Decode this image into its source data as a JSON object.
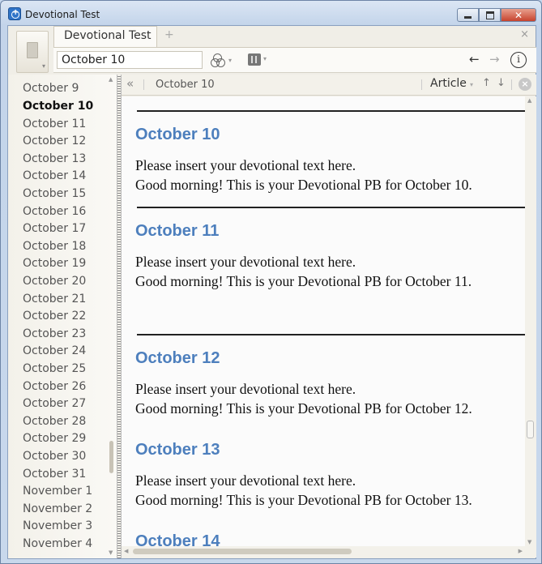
{
  "window": {
    "title": "Devotional Test"
  },
  "tab": {
    "label": "Devotional Test",
    "add_glyph": "+",
    "close_glyph": "×"
  },
  "toolbar": {
    "reference_value": "October 10",
    "back_glyph": "←",
    "forward_glyph": "→",
    "info_glyph": "i",
    "icons": [
      "library-book-icon",
      "resource-links-icon",
      "panels-icon",
      "back-arrow-icon",
      "forward-arrow-icon",
      "info-icon"
    ]
  },
  "sidebar": {
    "items": [
      {
        "label": "October 9",
        "active": false
      },
      {
        "label": "October 10",
        "active": true
      },
      {
        "label": "October 11",
        "active": false
      },
      {
        "label": "October 12",
        "active": false
      },
      {
        "label": "October 13",
        "active": false
      },
      {
        "label": "October 14",
        "active": false
      },
      {
        "label": "October 15",
        "active": false
      },
      {
        "label": "October 16",
        "active": false
      },
      {
        "label": "October 17",
        "active": false
      },
      {
        "label": "October 18",
        "active": false
      },
      {
        "label": "October 19",
        "active": false
      },
      {
        "label": "October 20",
        "active": false
      },
      {
        "label": "October 21",
        "active": false
      },
      {
        "label": "October 22",
        "active": false
      },
      {
        "label": "October 23",
        "active": false
      },
      {
        "label": "October 24",
        "active": false
      },
      {
        "label": "October 25",
        "active": false
      },
      {
        "label": "October 26",
        "active": false
      },
      {
        "label": "October 27",
        "active": false
      },
      {
        "label": "October 28",
        "active": false
      },
      {
        "label": "October 29",
        "active": false
      },
      {
        "label": "October 30",
        "active": false
      },
      {
        "label": "October 31",
        "active": false
      },
      {
        "label": "November 1",
        "active": false
      },
      {
        "label": "November 2",
        "active": false
      },
      {
        "label": "November 3",
        "active": false
      },
      {
        "label": "November 4",
        "active": false
      }
    ]
  },
  "content_header": {
    "collapse_glyph": "«",
    "reference": "October 10",
    "article_label": "Article",
    "up_glyph": "↑",
    "down_glyph": "↓",
    "close_glyph": "×"
  },
  "document": {
    "entries": [
      {
        "heading": "October 10",
        "line1": "Please insert your devotional text here.",
        "line2": "Good morning! This is your Devotional PB for October 10."
      },
      {
        "heading": "October 11",
        "line1": "Please insert your devotional text here.",
        "line2": "Good morning! This is your Devotional PB for October 11."
      },
      {
        "heading": "October 12",
        "line1": "Please insert your devotional text here.",
        "line2": "Good morning! This is your Devotional PB for October 12."
      },
      {
        "heading": "October 13",
        "line1": "Please insert your devotional text here.",
        "line2": "Good morning! This is your Devotional PB for October 13."
      },
      {
        "heading": "October 14"
      }
    ]
  },
  "colors": {
    "heading": "#4d7fbd",
    "frame": "#c7d8ee"
  }
}
